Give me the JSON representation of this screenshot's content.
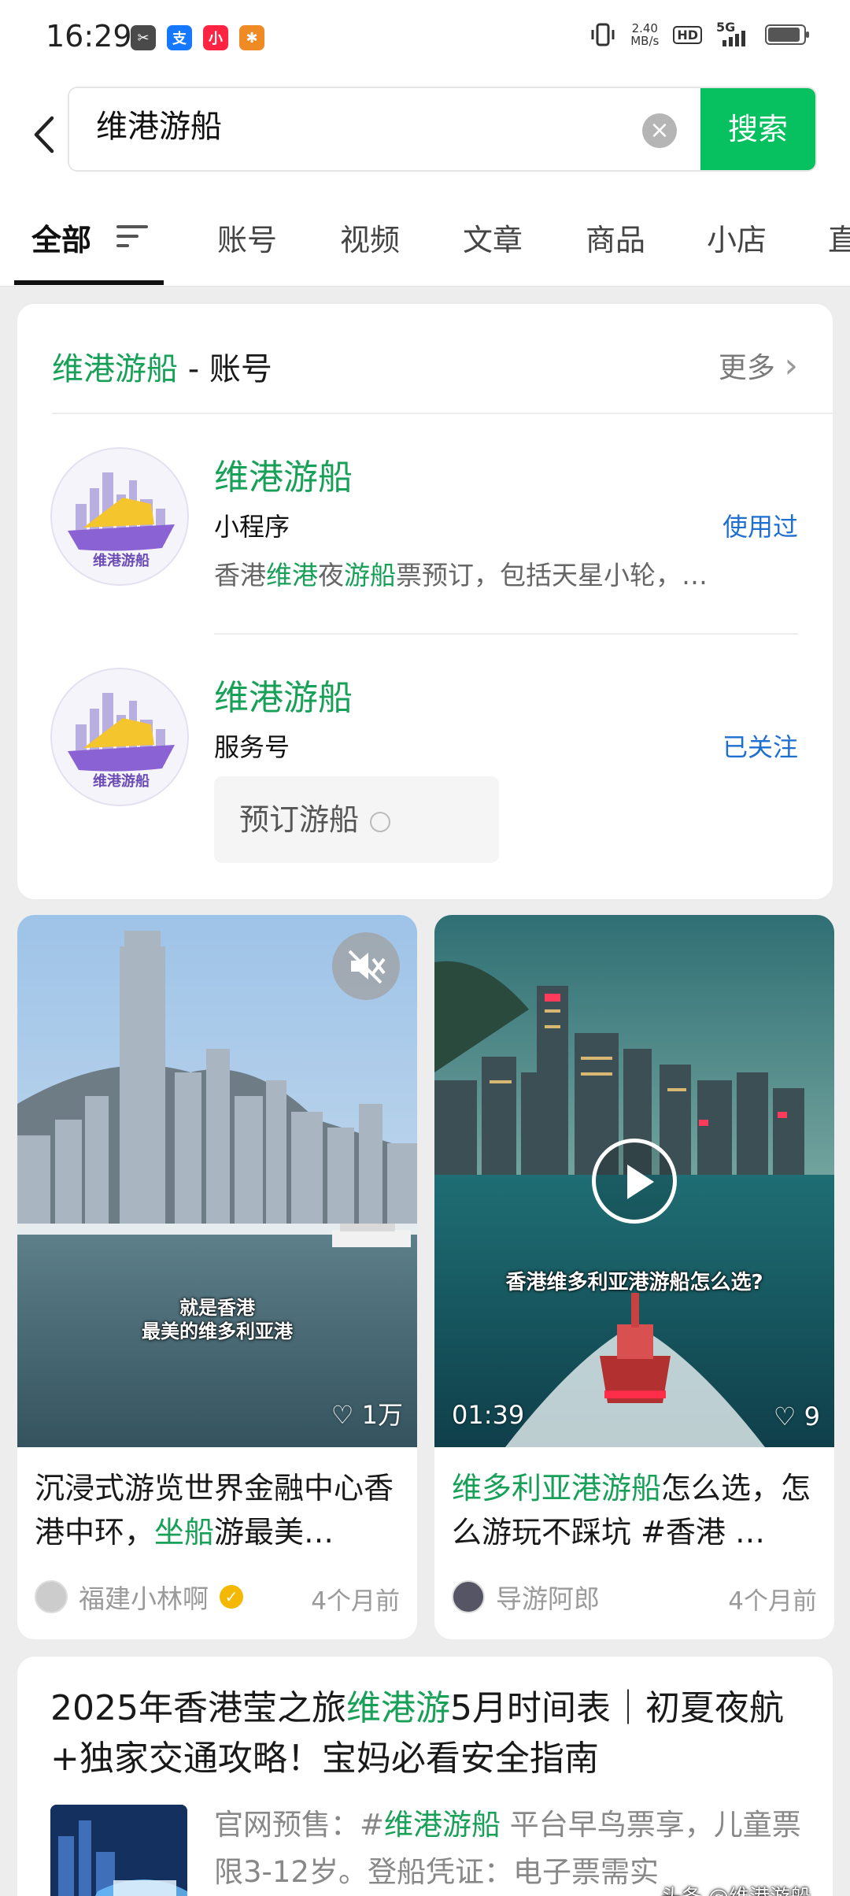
{
  "status_bar": {
    "time": "16:29",
    "net_speed_value": "2.40",
    "net_speed_unit": "MB/s",
    "hd": "HD",
    "network": "5G",
    "app_icons": [
      "scissors-app-icon",
      "alipay-app-icon",
      "xiaohongshu-app-icon",
      "running-app-icon"
    ],
    "app_icon_glyphs": [
      "✂",
      "支",
      "小",
      "✱"
    ],
    "app_icon_colors": [
      "#4a4a4a",
      "#1677ff",
      "#ff2442",
      "#f08a24"
    ]
  },
  "search": {
    "query": "维港游船",
    "button_label": "搜索",
    "clear_glyph": "×"
  },
  "tabs": [
    {
      "label": "全部"
    },
    {
      "label": "账号"
    },
    {
      "label": "视频"
    },
    {
      "label": "文章"
    },
    {
      "label": "商品"
    },
    {
      "label": "小店"
    },
    {
      "label": "直"
    }
  ],
  "account_section": {
    "title_highlight": "维港游船",
    "title_suffix": " - 账号",
    "more_label": "更多",
    "more_glyph": "›",
    "accounts": [
      {
        "name": "维港游船",
        "type": "小程序",
        "status": "使用过",
        "avatar_text": "维港游船",
        "desc_parts": [
          "香港",
          "维港",
          "夜",
          "游船",
          "票预订，包括天星小轮，…"
        ]
      },
      {
        "name": "维港游船",
        "type": "服务号",
        "status": "已关注",
        "avatar_text": "维港游船",
        "service_button": "预订游船"
      }
    ]
  },
  "videos": [
    {
      "overlay_line1": "就是香港",
      "overlay_line2": "最美的维多利亚港",
      "likes": "1万",
      "title_parts": [
        "沉浸式游览世界金融中心香港中环，",
        "坐船",
        "游最美…"
      ],
      "author": "福建小林啊",
      "verified": true,
      "time": "4个月前"
    },
    {
      "overlay_line1": "香港维多利亚港游船怎么选?",
      "duration": "01:39",
      "likes": "9",
      "title_parts": [
        "维多利亚港游船",
        "怎么选，怎么游玩不踩坑 #香港 …"
      ],
      "author": "导游阿郎",
      "time": "4个月前"
    }
  ],
  "article": {
    "title_parts": [
      "2025年香港莹之旅",
      "维港游",
      "5月时间表｜初夏夜航+独家交通攻略！宝妈必看安全指南"
    ],
    "desc_parts": [
      "官网预售：#",
      "维港游船",
      " 平台早鸟票享，儿童票限3-12岁。登船凭证：电子票需实"
    ],
    "watermark": "头条 @维港游船"
  },
  "colors": {
    "brand_green": "#07c160",
    "highlight_green": "#18a058",
    "link_blue": "#1e6fd0"
  }
}
